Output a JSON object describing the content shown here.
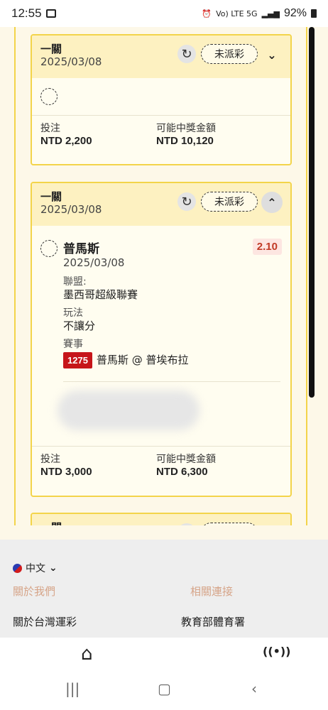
{
  "status_bar": {
    "time": "12:55",
    "network": "Vo) LTE 5G",
    "battery": "92%"
  },
  "bets": [
    {
      "title": "一關",
      "date": "2025/03/08",
      "status": "未派彩",
      "stake_label": "投注",
      "stake_value": "NTD 2,200",
      "payout_label": "可能中獎金額",
      "payout_value": "NTD 10,120"
    },
    {
      "title": "一關",
      "date": "2025/03/08",
      "status": "未派彩",
      "selection": {
        "name": "普馬斯",
        "date": "2025/03/08",
        "odds": "2.10",
        "league_label": "聯盟:",
        "league_value": "墨西哥超級聯賽",
        "play_label": "玩法",
        "play_value": "不讓分",
        "event_label": "賽事",
        "match_number": "1275",
        "match_name": "普馬斯 @ 普埃布拉"
      },
      "stake_label": "投注",
      "stake_value": "NTD 3,000",
      "payout_label": "可能中獎金額",
      "payout_value": "NTD 6,300"
    },
    {
      "title": "一關"
    }
  ],
  "footer": {
    "language": "中文",
    "about_header": "關於我們",
    "links_header": "相關連接",
    "about_link": "關於台灣運彩",
    "related_link": "教育部體育署"
  },
  "colors": {
    "card_border": "#f3d44a",
    "card_header": "#fdf1c1",
    "odds_text": "#c13a25",
    "match_badge": "#c6151a",
    "footer_header": "#d6a488"
  },
  "icons": [
    "refresh-icon",
    "chevron-down-icon",
    "chevron-up-icon",
    "home-icon",
    "live-icon",
    "flag-icon"
  ]
}
